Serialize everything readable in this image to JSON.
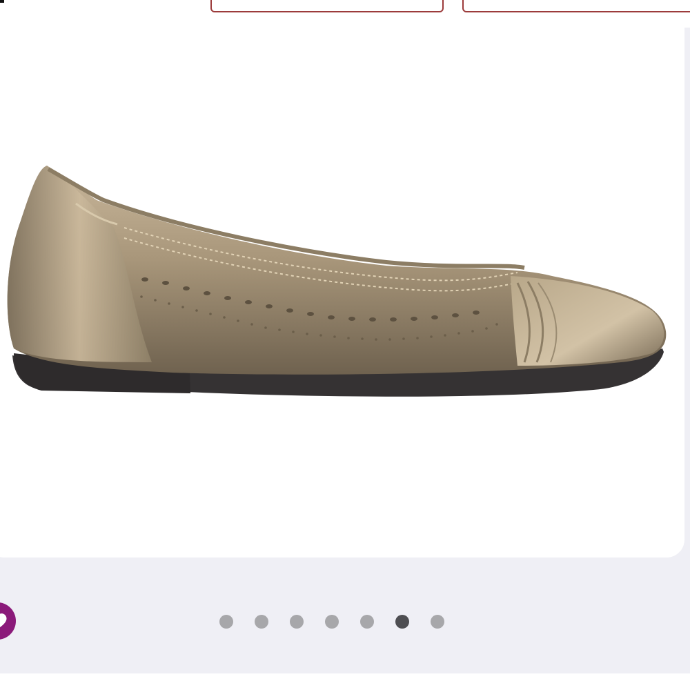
{
  "carousel": {
    "total": 7,
    "active_index": 5
  },
  "colors": {
    "brand_purple": "#8b1a7a",
    "button_border": "#9c3b3b",
    "dot_inactive": "#a7a7aa",
    "dot_active": "#4e4e52"
  },
  "icons": {
    "favorite": "heart-icon"
  }
}
